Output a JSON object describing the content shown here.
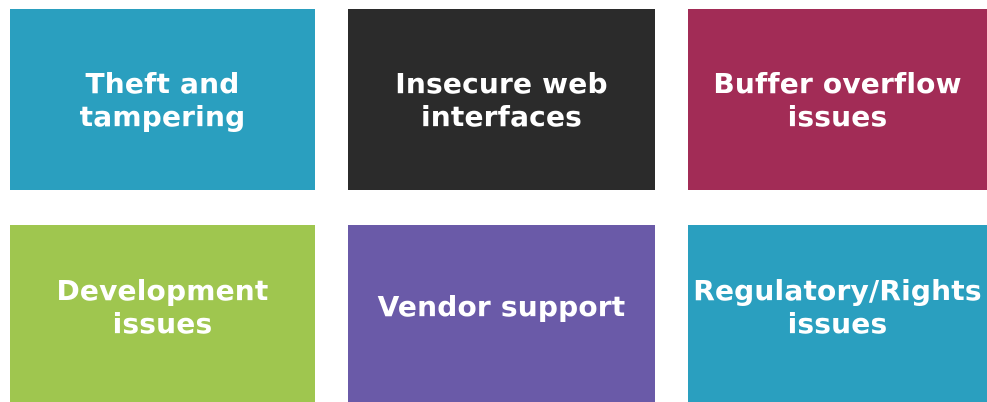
{
  "tiles": [
    {
      "label": "Theft and\ntampering",
      "color": "#2a9fbf"
    },
    {
      "label": "Insecure web\ninterfaces",
      "color": "#2b2b2b"
    },
    {
      "label": "Buffer overflow\nissues",
      "color": "#a22c56"
    },
    {
      "label": "Development\nissues",
      "color": "#9fc64f"
    },
    {
      "label": "Vendor support",
      "color": "#6a5aa8"
    },
    {
      "label": "Regulatory/Rights\nissues",
      "color": "#2a9fbf"
    }
  ]
}
